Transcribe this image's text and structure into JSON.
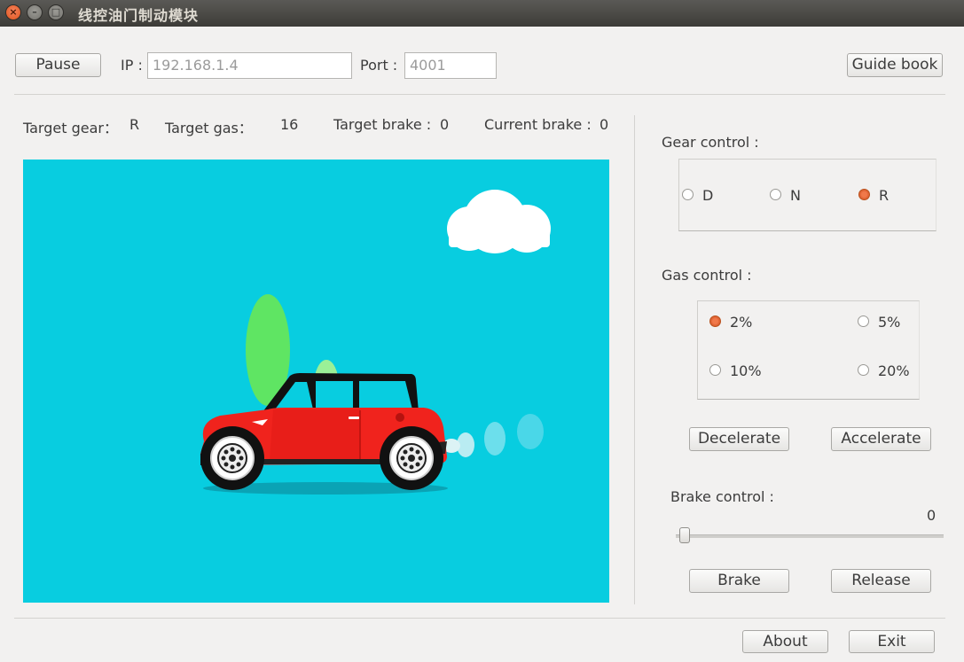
{
  "window": {
    "title": "线控油门制动模块"
  },
  "toolbar": {
    "pause_label": "Pause",
    "ip_label": "IP :",
    "ip_value": "192.168.1.4",
    "port_label": "Port :",
    "port_value": "4001",
    "guide_label": "Guide book"
  },
  "status": {
    "target_gear_label": "Target gear：",
    "target_gear_value": "R",
    "target_gas_label": "Target gas：",
    "target_gas_value": "16",
    "target_brake_label": "Target brake :",
    "target_brake_value": "0",
    "current_brake_label": "Current brake :",
    "current_brake_value": "0"
  },
  "gear": {
    "title": "Gear control :",
    "options": [
      "D",
      "N",
      "R"
    ],
    "selected": "R"
  },
  "gas": {
    "title": "Gas control :",
    "options": [
      "2%",
      "5%",
      "10%",
      "20%"
    ],
    "selected": "2%",
    "decelerate_label": "Decelerate",
    "accelerate_label": "Accelerate"
  },
  "brake": {
    "title": "Brake control :",
    "value": "0",
    "slider_fraction": 0,
    "brake_label": "Brake",
    "release_label": "Release"
  },
  "footer": {
    "about_label": "About",
    "exit_label": "Exit"
  },
  "colors": {
    "scene_sky": "#08cde0",
    "car_body": "#f0231d",
    "radio_selected": "#e5683a"
  }
}
